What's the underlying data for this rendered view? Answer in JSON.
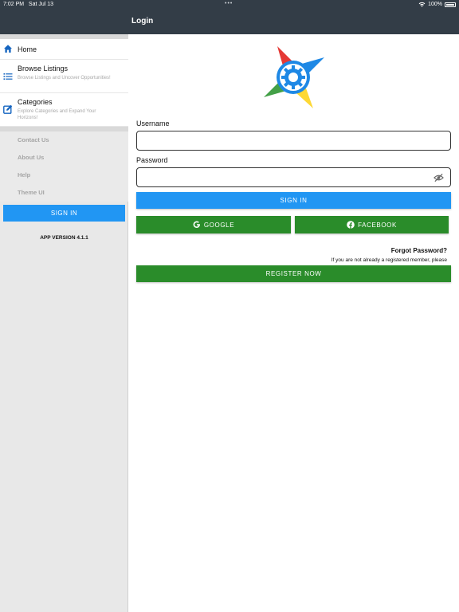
{
  "status_bar": {
    "time": "7:02 PM",
    "date": "Sat Jul 13",
    "battery": "100%"
  },
  "sidebar": {
    "items": [
      {
        "title": "Home",
        "subtitle": "",
        "icon": "home-icon"
      },
      {
        "title": "Browse Listings",
        "subtitle": "Browse Listings and Uncover Opportunities!",
        "icon": "list-icon"
      },
      {
        "title": "Categories",
        "subtitle": "Explore Categories and Expand Your Horizons!",
        "icon": "edit-icon"
      }
    ],
    "links": [
      "Contact Us",
      "About Us",
      "Help",
      "Theme UI"
    ],
    "sign_in_label": "SIGN IN",
    "app_version": "APP VERSION 4.1.1"
  },
  "header": {
    "title": "Login"
  },
  "form": {
    "username_label": "Username",
    "username_value": "",
    "password_label": "Password",
    "password_value": "",
    "sign_in_label": "SIGN IN",
    "google_label": "GOOGLE",
    "facebook_label": "FACEBOOK",
    "forgot_label": "Forgot Password?",
    "register_note": "If you are not already a registered member, please",
    "register_label": "REGISTER NOW"
  },
  "colors": {
    "header": "#333d47",
    "primary_blue": "#2196f3",
    "social_green": "#2a8c2a",
    "sidebar_bg": "#e8e8e8"
  }
}
